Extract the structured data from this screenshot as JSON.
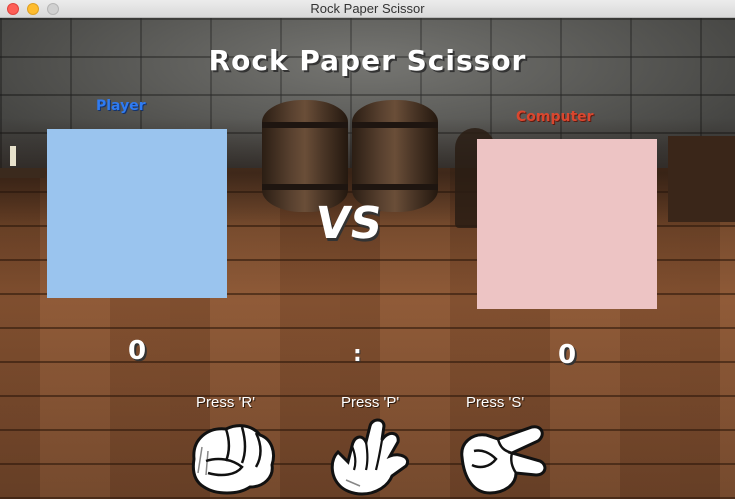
{
  "window": {
    "title": "Rock Paper Scissor"
  },
  "game": {
    "title": "Rock Paper Scissor",
    "player_label": "Player",
    "computer_label": "Computer",
    "vs_text": "VS",
    "score": {
      "player": "0",
      "separator": ":",
      "computer": "0"
    },
    "hints": {
      "rock": "Press 'R'",
      "paper": "Press 'P'",
      "scissor": "Press 'S'"
    },
    "hands": [
      {
        "name": "rock",
        "icon": "rock-hand-icon"
      },
      {
        "name": "paper",
        "icon": "paper-hand-icon"
      },
      {
        "name": "scissor",
        "icon": "scissor-hand-icon"
      }
    ]
  },
  "colors": {
    "player_box": "#9ac4ee",
    "computer_box": "#edc4c4",
    "player_label": "#2f7bf2",
    "computer_label": "#d9472f"
  }
}
